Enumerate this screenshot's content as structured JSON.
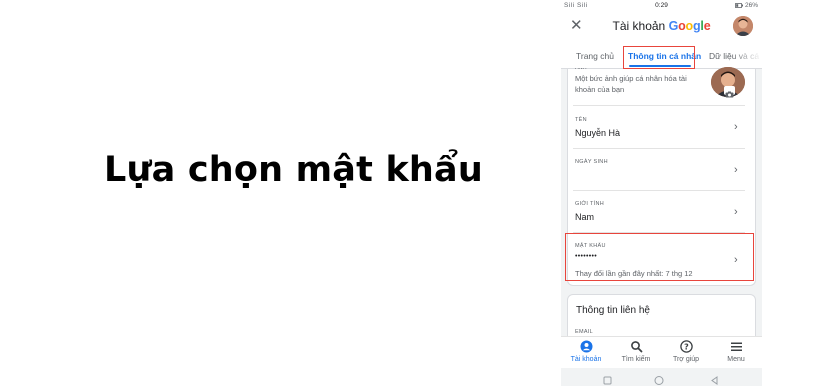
{
  "caption": "Lựa chọn mật khẩu",
  "status_bar": {
    "left": "Sili Sili",
    "time": "0:29",
    "right": "26%"
  },
  "app_bar": {
    "title_prefix": "Tài khoản",
    "brand": [
      "G",
      "o",
      "o",
      "g",
      "l",
      "e"
    ]
  },
  "tabs": [
    "Trang chủ",
    "Thông tin cá nhân",
    "Dữ liệu và cá n"
  ],
  "profile": {
    "photo_label": "ẢNH",
    "photo_text": "Một bức ảnh giúp cá nhân hóa tài khoản của bạn",
    "rows": [
      {
        "label": "TÊN",
        "value": "Nguyễn Hà"
      },
      {
        "label": "NGÀY SINH",
        "value": ""
      },
      {
        "label": "GIỚI TÍNH",
        "value": "Nam"
      }
    ],
    "password": {
      "label": "MẬT KHẨU",
      "value": "••••••••",
      "note": "Thay đổi lần gần đây nhất: 7 thg 12"
    }
  },
  "contact": {
    "title": "Thông tin liên hệ",
    "email_label": "EMAIL"
  },
  "bottom_nav": [
    "Tài khoản",
    "Tìm kiếm",
    "Trợ giúp",
    "Menu"
  ],
  "colors": {
    "accent": "#1a73e8",
    "highlight": "#e8453c",
    "google_blue": "#4285f4",
    "google_red": "#ea4335",
    "google_yellow": "#fbbc05",
    "google_green": "#34a853"
  }
}
